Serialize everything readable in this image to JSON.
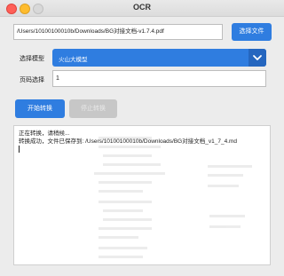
{
  "window": {
    "title": "OCR"
  },
  "file": {
    "path": "/Users/10100100010b/Downloads/BG对接文档-v1.7.4.pdf",
    "choose_button": "选择文件"
  },
  "model": {
    "label": "选择模型",
    "selected": "火山大模型",
    "icon": "chevron-down-icon"
  },
  "page": {
    "label": "页码选择",
    "value": "1"
  },
  "actions": {
    "start": "开始转换",
    "stop": "停止转换"
  },
  "log": {
    "lines": [
      "正在转换，请稍候...",
      "转换成功，文件已保存到: /Users/10100100010b/Downloads/BG对接文档_v1_7_4.md"
    ]
  },
  "colors": {
    "accent": "#2f7de0",
    "disabled": "#c7c7c7"
  }
}
